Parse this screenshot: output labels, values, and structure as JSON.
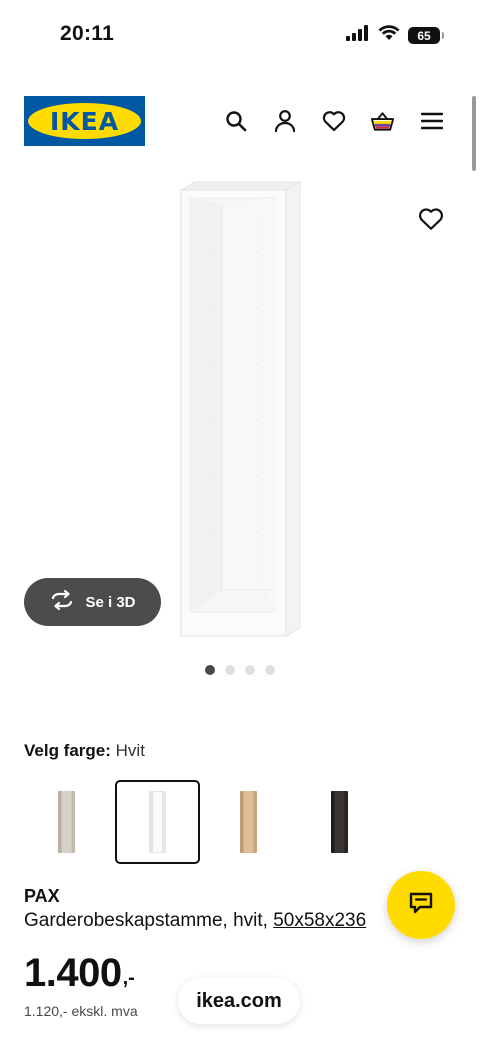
{
  "status_bar": {
    "time": "20:11",
    "battery": "65"
  },
  "header": {
    "logo_text": "IKEA",
    "brand_colors": {
      "blue": "#0058a3",
      "yellow": "#ffdb00"
    },
    "icons": [
      "search-icon",
      "account-icon",
      "heart-icon",
      "basket-icon",
      "menu-icon"
    ]
  },
  "gallery": {
    "view_3d_label": "Se i 3D",
    "dots_total": 4,
    "active_dot": 1
  },
  "color_picker": {
    "label": "Velg farge:",
    "selected_value": "Hvit",
    "swatches": [
      {
        "name": "beige",
        "color": "#c9c3b6",
        "selected": false
      },
      {
        "name": "hvit",
        "color": "#f4f4f4",
        "selected": true
      },
      {
        "name": "eik",
        "color": "#d5b38c",
        "selected": false
      },
      {
        "name": "svartbrun",
        "color": "#2e2b29",
        "selected": false
      }
    ]
  },
  "product": {
    "name": "PAX",
    "description": "Garderobeskapstamme, hvit, ",
    "dimensions": "50x58x236",
    "price_integer": "1.400",
    "price_decimal": ",-",
    "price_excl_vat": "1.120,- ekskl. mva"
  },
  "browser": {
    "url": "ikea.com"
  }
}
